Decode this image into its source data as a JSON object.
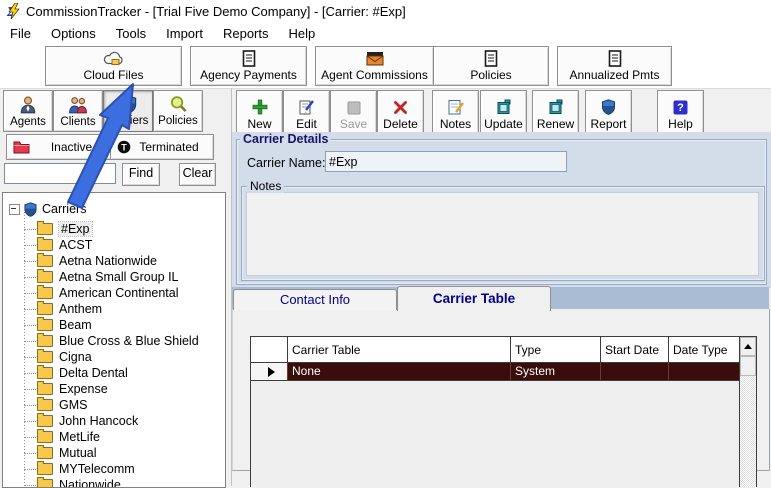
{
  "window": {
    "title": "CommissionTracker - [Trial Five Demo Company] - [Carrier: #Exp]",
    "app_icon": "sigma-lightning-icon"
  },
  "menu_bar": {
    "items": [
      "File",
      "Options",
      "Tools",
      "Import",
      "Reports",
      "Help"
    ]
  },
  "top_toolbar": {
    "buttons": [
      {
        "label": "Cloud Files",
        "icon": "cloud-icon"
      },
      {
        "label": "Agency Payments",
        "icon": "document-icon"
      },
      {
        "label": "Agent Commissions",
        "icon": "mail-icon"
      },
      {
        "label": "Policies",
        "icon": "document-icon"
      },
      {
        "label": "Annualized Pmts",
        "icon": "document-icon"
      }
    ]
  },
  "annotation": {
    "arrow_color": "#3d6ee0",
    "arrow_outline": "#2d4fb0",
    "arrow_points_to": "Cloud Files"
  },
  "sidebar": {
    "category_tabs": [
      {
        "label": "Agents",
        "icon": "agent-person-icon",
        "active": false
      },
      {
        "label": "Clients",
        "icon": "clients-people-icon",
        "active": false
      },
      {
        "label": "Carriers",
        "icon": "carrier-shield-icon",
        "active": true
      },
      {
        "label": "Policies",
        "icon": "magnifier-icon",
        "active": false
      }
    ],
    "filters": [
      {
        "label": "Inactive",
        "icon": "red-folder-icon"
      },
      {
        "label": "Terminated",
        "icon": "terminated-circle-icon"
      }
    ],
    "search": {
      "value": "",
      "find_label": "Find",
      "clear_label": "Clear"
    },
    "tree": {
      "root_label": "Carriers",
      "root_icon": "carrier-shield-icon",
      "selected_item": "#Exp",
      "items": [
        "#Exp",
        "ACST",
        "Aetna Nationwide",
        "Aetna Small Group IL",
        "American Continental",
        "Anthem",
        "Beam",
        "Blue Cross & Blue Shield",
        "Cigna",
        "Delta Dental",
        "Expense",
        "GMS",
        "John Hancock",
        "MetLife",
        "Mutual",
        "MYTelecomm",
        "Nationwide"
      ]
    }
  },
  "detail_toolbar": {
    "buttons": [
      {
        "label": "New",
        "icon": "plus-icon",
        "disabled": false
      },
      {
        "label": "Edit",
        "icon": "edit-doc-icon",
        "disabled": false
      },
      {
        "label": "Save",
        "icon": "save-icon",
        "disabled": true
      },
      {
        "label": "Delete",
        "icon": "delete-x-icon",
        "disabled": false
      },
      {
        "label": "Notes",
        "icon": "notes-doc-icon",
        "disabled": false
      },
      {
        "label": "Update",
        "icon": "update-scroll-icon",
        "disabled": false
      },
      {
        "label": "Renew",
        "icon": "renew-scroll-icon",
        "disabled": false
      },
      {
        "label": "Report",
        "icon": "report-shield-icon",
        "disabled": false
      },
      {
        "label": "Help",
        "icon": "help-icon",
        "disabled": false
      }
    ]
  },
  "carrier_details": {
    "group_title": "Carrier Details",
    "name_label": "Carrier Name:",
    "name_value": "#Exp",
    "notes_title": "Notes",
    "notes_value": ""
  },
  "detail_tabs": [
    {
      "label": "Contact Info",
      "active": false
    },
    {
      "label": "Carrier Table",
      "active": true
    }
  ],
  "carrier_table": {
    "columns": [
      "Carrier Table",
      "Type",
      "Start Date",
      "Date Type"
    ],
    "rows": [
      [
        "None",
        "System",
        "",
        ""
      ]
    ],
    "selected_row_index": 0,
    "selected_row_color": "#3a0d0b"
  }
}
